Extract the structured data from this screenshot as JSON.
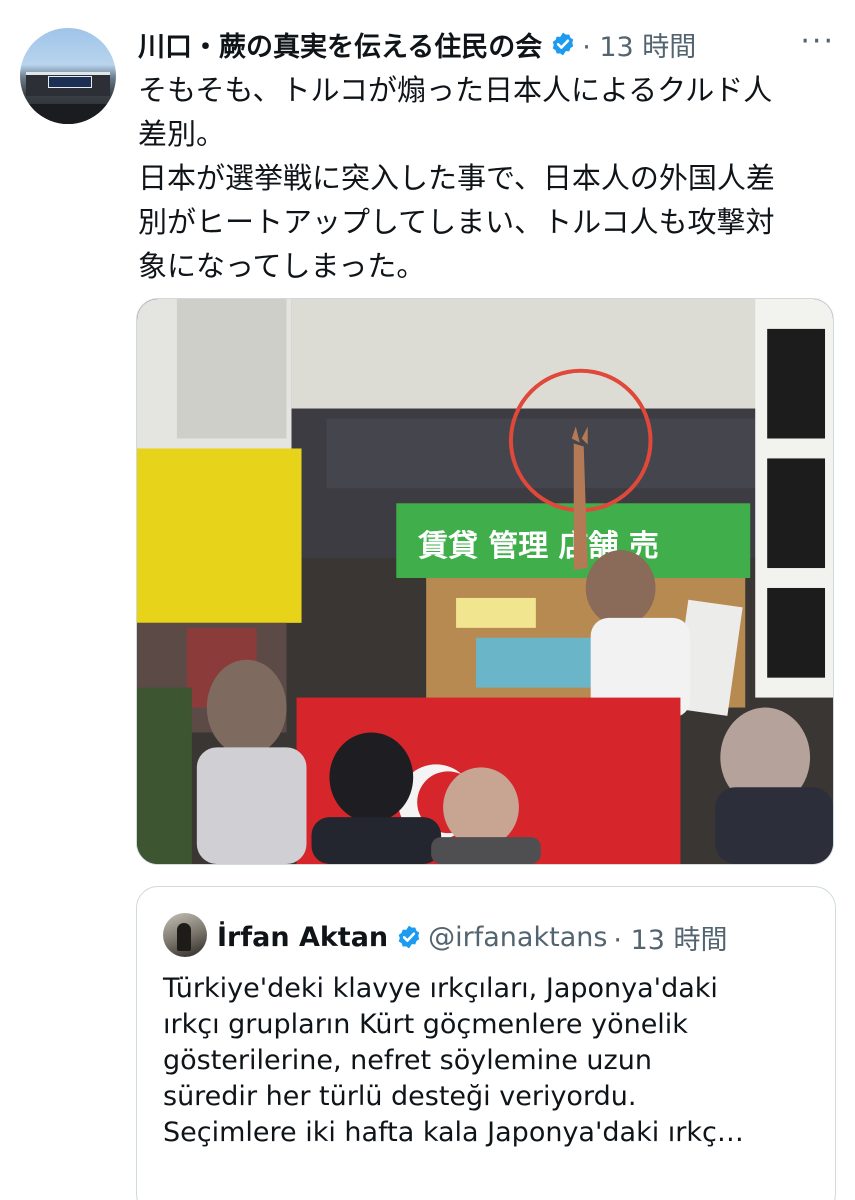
{
  "tweet": {
    "author": {
      "display_name": "川口・蕨の真実を伝える住民の会",
      "verified": true,
      "avatar_icon": "station-building-avatar"
    },
    "timestamp": "· 13 時間",
    "more_icon": "more-options-icon",
    "text": "そもそも、トルコが煽った日本人によるクルド人\n差別。\n日本が選挙戦に突入した事で、日本人の外国人差\n別がヒートアップしてしまい、トルコ人も攻撃対\n象になってしまった。",
    "media": {
      "type": "photo",
      "description_icon": "street-protest-photo",
      "storefront_sign": "賃貸 管理 店舗 売",
      "highlight_color": "#e0483a"
    }
  },
  "quoted_tweet": {
    "author": {
      "display_name": "İrfan Aktan",
      "verified": true,
      "handle": "@irfanaktans",
      "timestamp": "· 13 時間"
    },
    "text": "Türkiye'deki klavye ırkçıları, Japonya'daki\nırkçı grupların Kürt göçmenlere yönelik\ngösterilerine, nefret söylemine uzun\nsüredir her türlü desteği veriyordu.\nSeçimlere iki hafta kala Japonya'daki ırkç…"
  },
  "colors": {
    "verified_blue": "#1d9bf0",
    "secondary_text": "#536471",
    "primary_text": "#0f1419",
    "border": "#cfd9de"
  }
}
